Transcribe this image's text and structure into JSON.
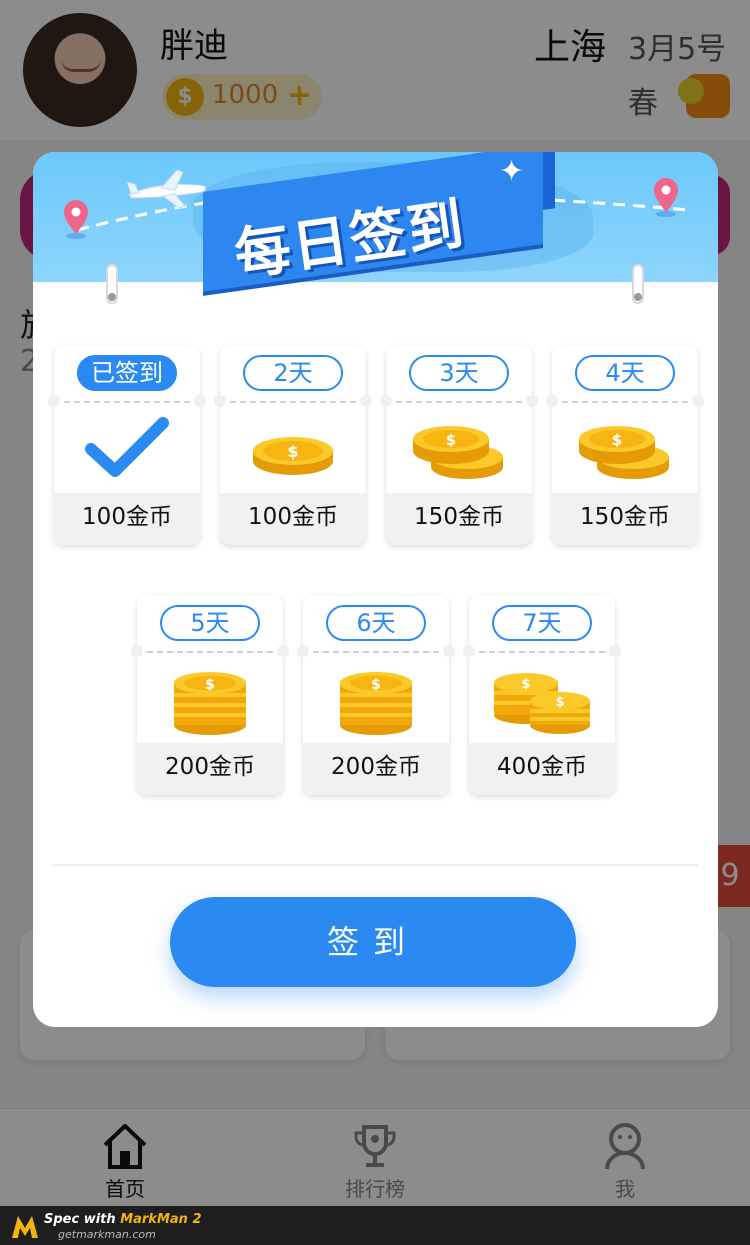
{
  "header": {
    "username": "胖迪",
    "coins": "1000",
    "coin_symbol": "$",
    "add_symbol": "+",
    "city": "上海",
    "date": "3月5号",
    "season": "春"
  },
  "background": {
    "text_line_1": "旅",
    "text_line_2": "2",
    "red_tab_text": "9"
  },
  "modal": {
    "title": "每日签到",
    "days": [
      {
        "label": "已签到",
        "reward": "100金币",
        "signed": true
      },
      {
        "label": "2天",
        "reward": "100金币",
        "signed": false
      },
      {
        "label": "3天",
        "reward": "150金币",
        "signed": false
      },
      {
        "label": "4天",
        "reward": "150金币",
        "signed": false
      },
      {
        "label": "5天",
        "reward": "200金币",
        "signed": false
      },
      {
        "label": "6天",
        "reward": "200金币",
        "signed": false
      },
      {
        "label": "7天",
        "reward": "400金币",
        "signed": false
      }
    ],
    "sign_button": "签到"
  },
  "tabbar": {
    "items": [
      {
        "label": "首页",
        "icon": "home-icon",
        "active": true
      },
      {
        "label": "排行榜",
        "icon": "trophy-icon",
        "active": false
      },
      {
        "label": "我",
        "icon": "profile-icon",
        "active": false
      }
    ]
  },
  "footer": {
    "title_prefix": "Spec with ",
    "title_accent": "MarkMan 2",
    "url": "getmarkman.com"
  },
  "colors": {
    "primary": "#2a8af2",
    "banner": "#6cc8fb",
    "coin": "#f5b40c",
    "overlay": "rgba(0,0,0,0.45)"
  }
}
